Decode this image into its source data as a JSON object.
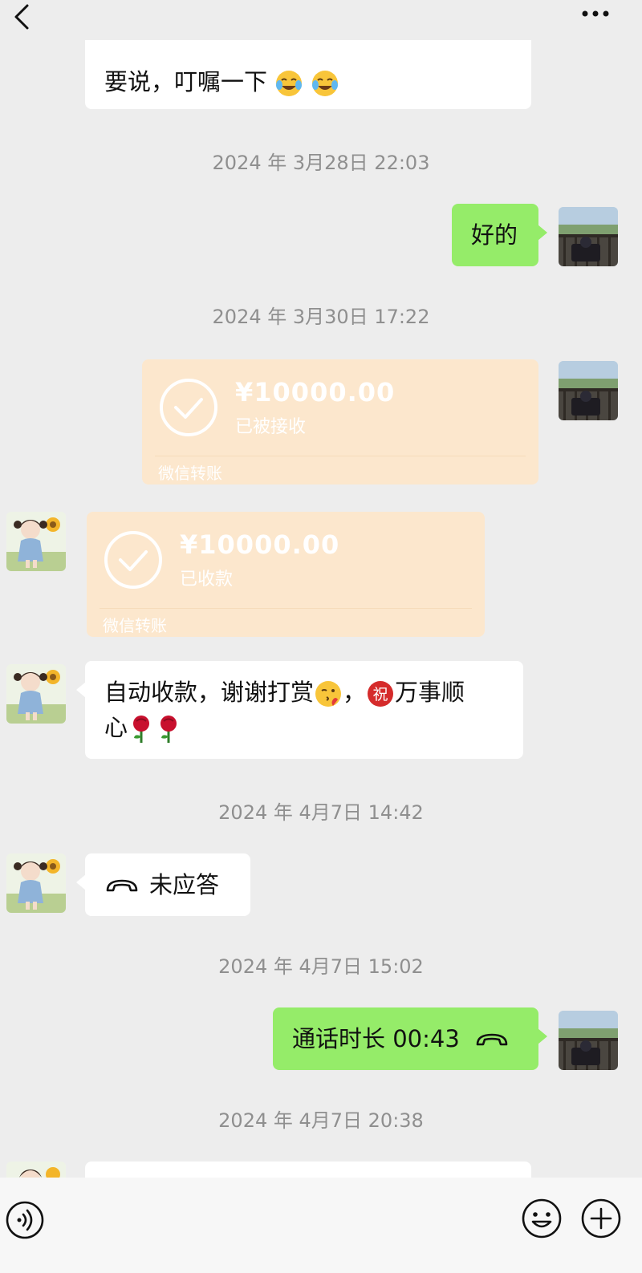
{
  "messages": {
    "m1_partial": "要说，叮嘱一下",
    "ts1": "2024 年 3月28日 22:03",
    "m2": "好的",
    "ts2": "2024 年 3月30日 17:22",
    "transfer_out": {
      "amount": "¥10000.00",
      "status": "已被接收",
      "footer": "微信转账"
    },
    "transfer_in": {
      "amount": "¥10000.00",
      "status": "已收款",
      "footer": "微信转账"
    },
    "m3_line1": "自动收款，谢谢打赏",
    "m3_wan": "万事顺",
    "m3_line2": "心",
    "ts3": "2024 年 4月7日 14:42",
    "missed_call": "未应答",
    "ts4": "2024 年 4月7日 15:02",
    "call_duration": "通话时长 00:43",
    "ts5": "2024 年 4月7日 20:38"
  },
  "icons": {
    "back": "chevron-left-icon",
    "more": "more-dots-icon",
    "voice": "voice-icon",
    "emoji": "emoji-icon",
    "plus": "plus-icon",
    "call": "phone-hangup-icon",
    "zhu": "祝"
  },
  "colors": {
    "background": "#ededed",
    "outgoing_bubble": "#95ec69",
    "incoming_bubble": "#ffffff",
    "transfer_card": "#fce7cd",
    "timestamp": "#8f8f8f"
  }
}
